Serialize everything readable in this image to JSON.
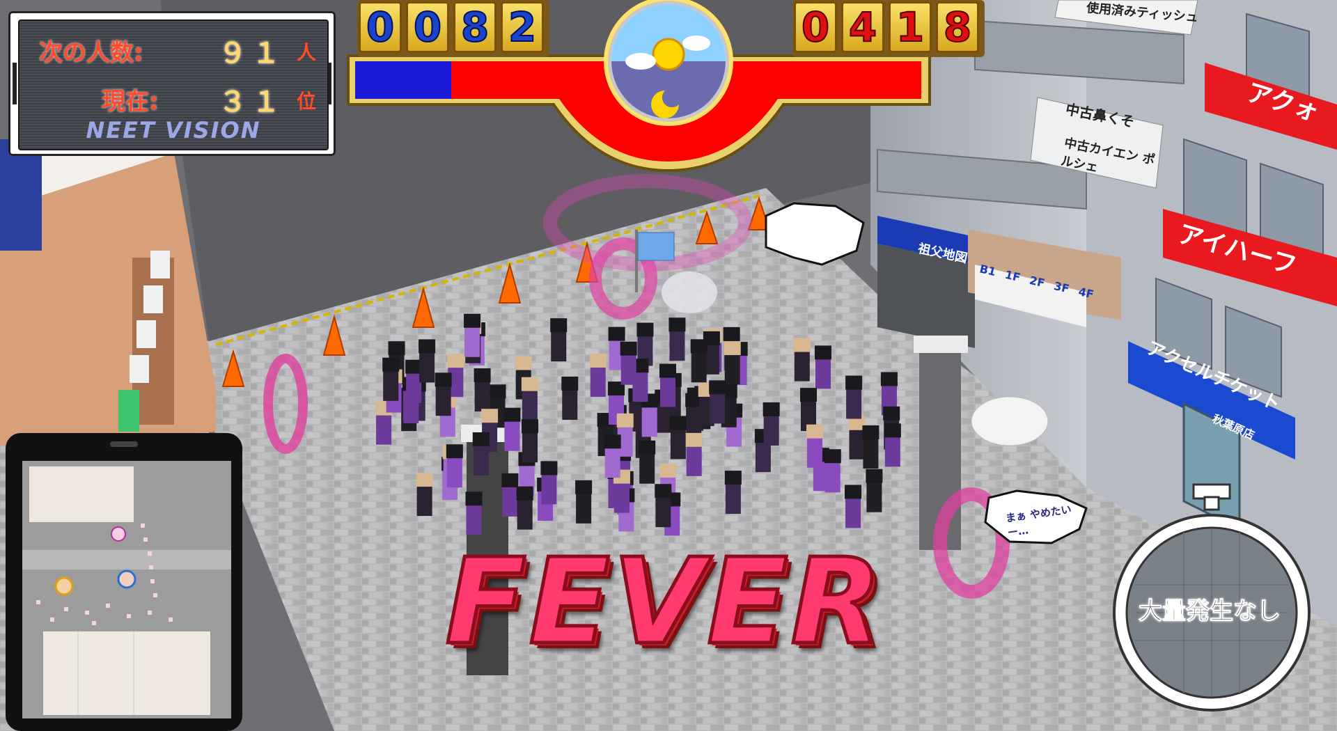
{
  "hud": {
    "next_count_label": "次の人数:",
    "next_count_value": "９１",
    "next_count_unit": "人",
    "rank_label": "現在:",
    "rank_value": "３１",
    "rank_unit": "位",
    "brand": "NEET VISION"
  },
  "score_left": [
    "0",
    "0",
    "8",
    "2"
  ],
  "score_right": [
    "0",
    "4",
    "1",
    "8"
  ],
  "progress_fraction": 0.17,
  "fever_text": "FEVER",
  "stopwatch_text": "大量発生なし",
  "speech_bubbles": [
    "まぁ やめたいー…"
  ],
  "building_signs": {
    "directory_2f": "使用済みティッシュ",
    "directory_1f": "中古鼻くそ",
    "directory_b1": "中古カイエン ポルシェ",
    "store_akuo": "アクォ",
    "store_heart": "アイハーフ",
    "store_accel": "アクセルチケット",
    "store_accel_branch": "秋葉原店",
    "store_sofu": "祖父地図",
    "floors": [
      "B1",
      "1F",
      "2F",
      "3F",
      "4F"
    ]
  },
  "colors": {
    "score_bar_blue": "#1a1ad8",
    "score_bar_red": "#ff0000",
    "fever": "#ff3a6e",
    "plaza_floor": "#b9b9bc"
  }
}
